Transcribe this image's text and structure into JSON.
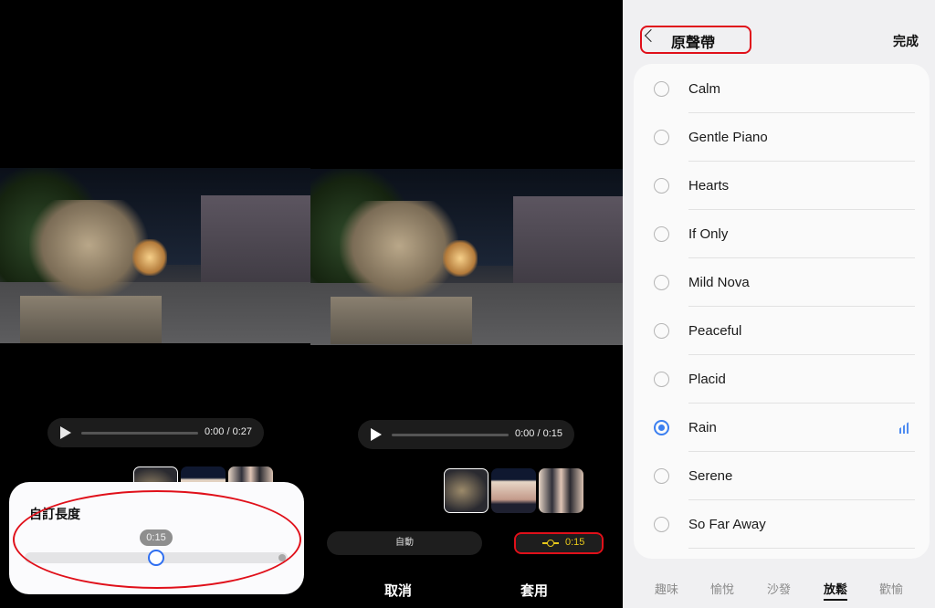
{
  "left_panel": {
    "time": "0:00 / 0:27",
    "custom_length": {
      "title": "自訂長度",
      "slider_value_label": "0:15",
      "slider_fraction": 0.5
    }
  },
  "middle_panel": {
    "time": "0:00 / 0:15",
    "auto_label": "自動",
    "duration_label": "0:15",
    "cancel_label": "取消",
    "apply_label": "套用"
  },
  "right_panel": {
    "title": "原聲帶",
    "done_label": "完成",
    "tracks": [
      {
        "name": "Calm"
      },
      {
        "name": "Gentle Piano"
      },
      {
        "name": "Hearts"
      },
      {
        "name": "If Only"
      },
      {
        "name": "Mild Nova"
      },
      {
        "name": "Peaceful"
      },
      {
        "name": "Placid"
      },
      {
        "name": "Rain",
        "selected": true
      },
      {
        "name": "Serene"
      },
      {
        "name": "So Far Away"
      }
    ],
    "tabs": [
      {
        "label": "趣味"
      },
      {
        "label": "愉悅"
      },
      {
        "label": "沙發"
      },
      {
        "label": "放鬆",
        "active": true
      },
      {
        "label": "歡愉"
      }
    ],
    "accent": "#3b7ff0"
  }
}
